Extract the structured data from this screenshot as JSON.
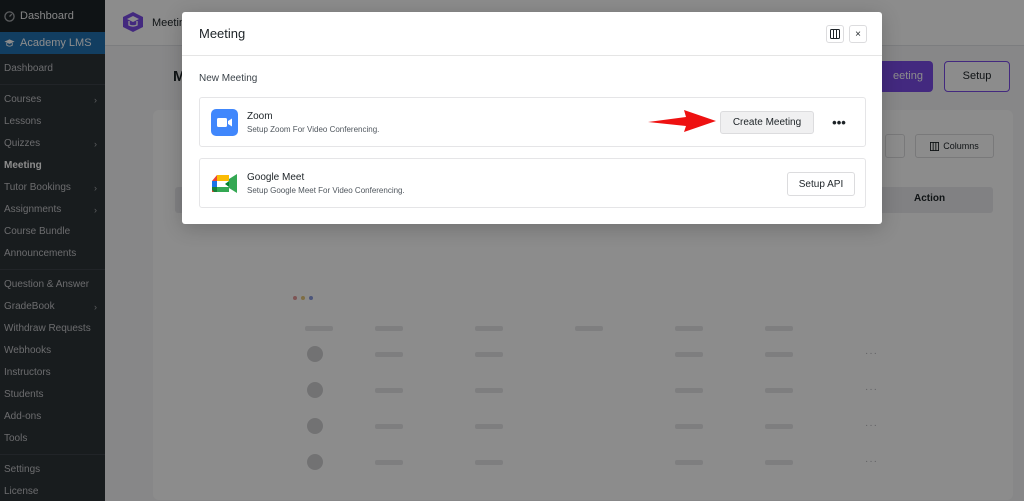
{
  "sidebar": {
    "dashboard_top": "Dashboard",
    "active_plugin": "Academy LMS",
    "items": [
      {
        "label": "Dashboard",
        "chevron": false,
        "current": false,
        "gap_before": false
      },
      {
        "label": "Courses",
        "chevron": true,
        "current": false,
        "gap_before": true
      },
      {
        "label": "Lessons",
        "chevron": false,
        "current": false,
        "gap_before": false
      },
      {
        "label": "Quizzes",
        "chevron": true,
        "current": false,
        "gap_before": false
      },
      {
        "label": "Meeting",
        "chevron": false,
        "current": true,
        "gap_before": false
      },
      {
        "label": "Tutor Bookings",
        "chevron": true,
        "current": false,
        "gap_before": false
      },
      {
        "label": "Assignments",
        "chevron": true,
        "current": false,
        "gap_before": false
      },
      {
        "label": "Course Bundle",
        "chevron": false,
        "current": false,
        "gap_before": false
      },
      {
        "label": "Announcements",
        "chevron": false,
        "current": false,
        "gap_before": false
      },
      {
        "label": "Question & Answer",
        "chevron": false,
        "current": false,
        "gap_before": true
      },
      {
        "label": "GradeBook",
        "chevron": true,
        "current": false,
        "gap_before": false
      },
      {
        "label": "Withdraw Requests",
        "chevron": false,
        "current": false,
        "gap_before": false
      },
      {
        "label": "Webhooks",
        "chevron": false,
        "current": false,
        "gap_before": false
      },
      {
        "label": "Instructors",
        "chevron": false,
        "current": false,
        "gap_before": false
      },
      {
        "label": "Students",
        "chevron": false,
        "current": false,
        "gap_before": false
      },
      {
        "label": "Add-ons",
        "chevron": false,
        "current": false,
        "gap_before": false
      },
      {
        "label": "Tools",
        "chevron": false,
        "current": false,
        "gap_before": false
      },
      {
        "label": "Settings",
        "chevron": false,
        "current": false,
        "gap_before": true
      },
      {
        "label": "License",
        "chevron": false,
        "current": false,
        "gap_before": false
      }
    ]
  },
  "background": {
    "topbar_title": "Meeting",
    "page_heading": "M",
    "primary_button_partial": "eeting",
    "setup_button": "Setup",
    "columns_button": "Columns",
    "action_header": "Action"
  },
  "modal": {
    "title": "Meeting",
    "section_label": "New Meeting",
    "providers": [
      {
        "name": "Zoom",
        "description": "Setup Zoom For Video Conferencing.",
        "button": "Create Meeting",
        "icon": "zoom-icon",
        "more": "•••"
      },
      {
        "name": "Google Meet",
        "description": "Setup Google Meet For Video Conferencing.",
        "button": "Setup API",
        "icon": "google-meet-icon"
      }
    ]
  },
  "colors": {
    "wp_sidebar": "#2c3338",
    "wp_active": "#2271b1",
    "brand_purple": "#7b4ce8",
    "zoom_blue": "#4087fc",
    "annotation_red": "#ee1111"
  }
}
